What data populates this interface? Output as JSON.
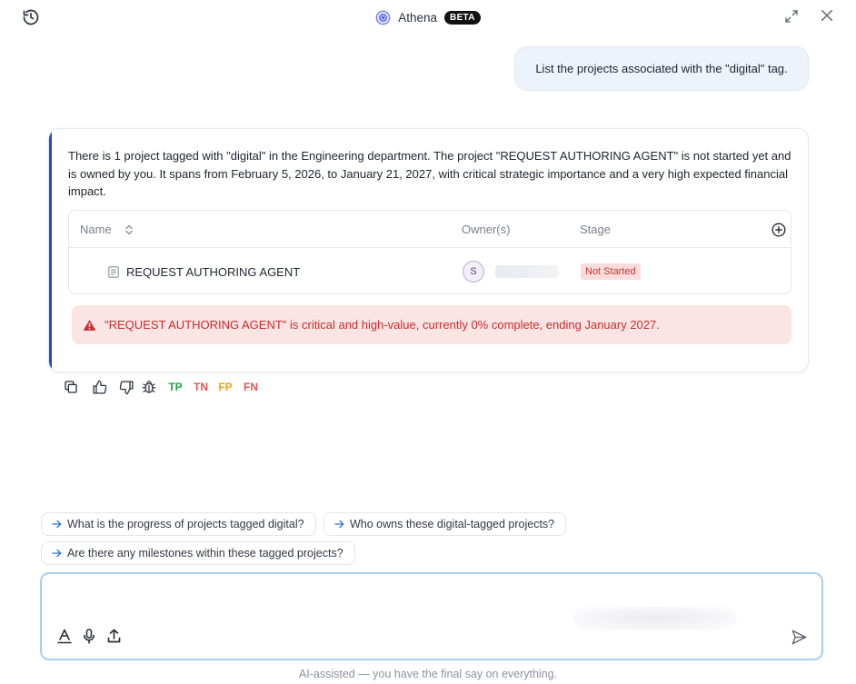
{
  "header": {
    "title": "Athena",
    "badge": "BETA"
  },
  "conversation": {
    "user_message": "List the projects associated with the \"digital\" tag.",
    "response_text": "There is 1 project tagged with \"digital\" in the Engineering department. The project \"REQUEST AUTHORING AGENT\" is not started yet and is owned by you. It spans from February 5, 2026, to January 21, 2027, with critical strategic importance and a very high expected financial impact.",
    "table": {
      "columns": [
        "Name",
        "Owner(s)",
        "Stage"
      ],
      "rows": [
        {
          "name": "REQUEST AUTHORING AGENT",
          "owner_initial": "S",
          "stage": "Not Started"
        }
      ]
    },
    "alert": "\"REQUEST AUTHORING AGENT\" is critical and high-value, currently 0% complete, ending January 2027."
  },
  "feedback": {
    "tags": [
      "TP",
      "TN",
      "FP",
      "FN"
    ]
  },
  "suggestions": [
    "What is the progress of projects tagged digital?",
    "Who owns these digital-tagged projects?",
    "Are there any milestones within these tagged projects?"
  ],
  "input": {
    "value": ""
  },
  "disclaimer": "AI-assisted — you have the final say on everything.",
  "colors": {
    "accent": "#1d4fc4",
    "alert_bg": "#fbe4e4",
    "alert_text": "#c72d2d",
    "tp": "#22a34a",
    "tn": "#e05555",
    "fp": "#e7a317",
    "fn": "#e05555"
  }
}
